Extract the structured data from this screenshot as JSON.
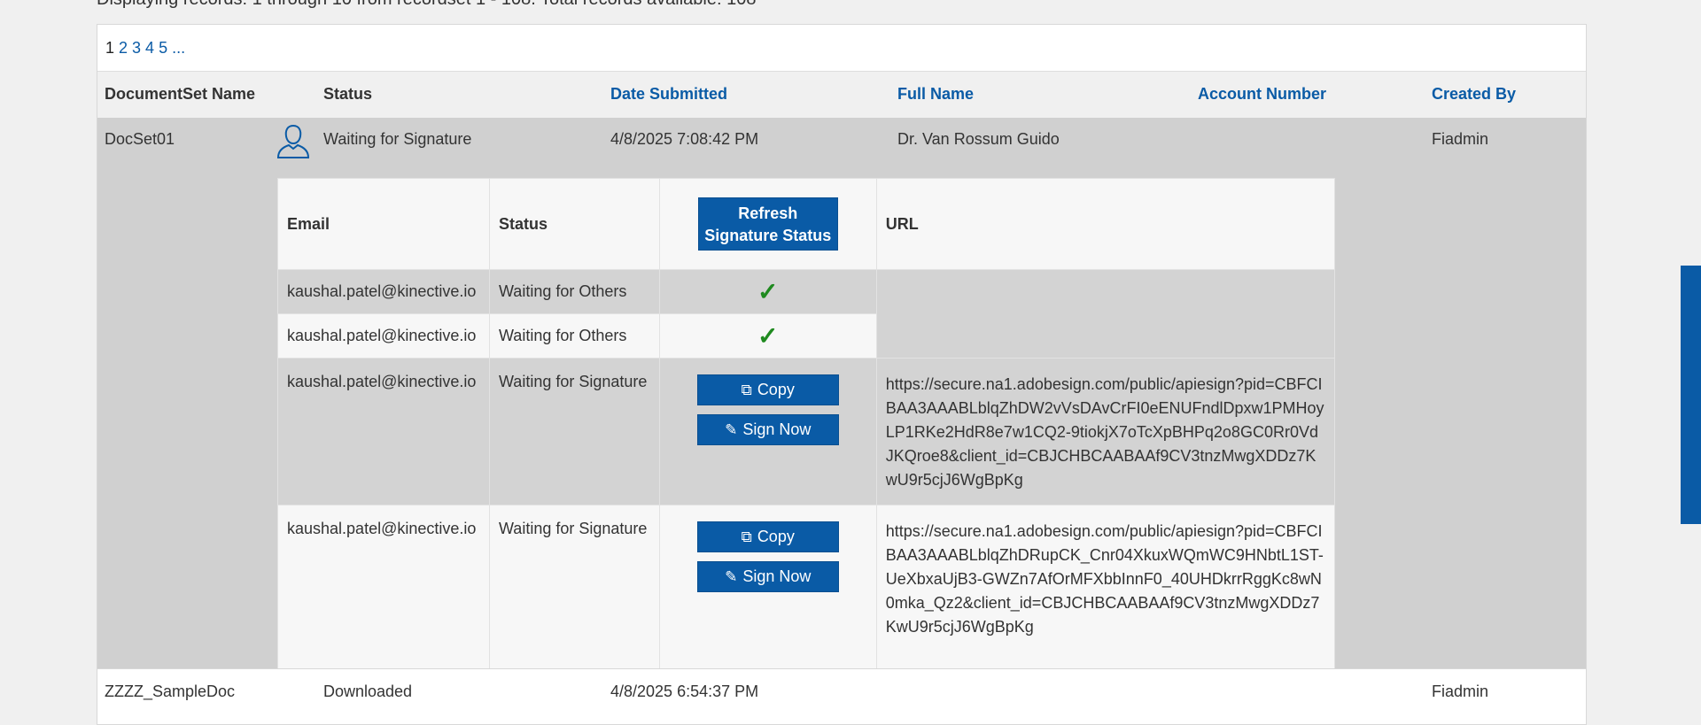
{
  "info": "Displaying records: 1 through 10 from recordset 1 - 108. Total records available: 108",
  "pager": {
    "pages": [
      "1",
      "2",
      "3",
      "4",
      "5"
    ],
    "ellipsis": "..."
  },
  "headers": {
    "docset_name": "DocumentSet Name",
    "status": "Status",
    "date_submitted": "Date Submitted",
    "full_name": "Full Name",
    "account_number": "Account Number",
    "created_by": "Created By"
  },
  "rows": [
    {
      "docset_name": "DocSet01",
      "status": "Waiting for Signature",
      "date_submitted": "4/8/2025 7:08:42 PM",
      "full_name": "Dr. Van Rossum Guido",
      "account_number": "",
      "created_by": "Fiadmin",
      "icon": "person-outline-icon"
    },
    {
      "docset_name": "ZZZZ_SampleDoc",
      "status": "Downloaded",
      "date_submitted": "4/8/2025 6:54:37 PM",
      "full_name": "",
      "account_number": "",
      "created_by": "Fiadmin"
    }
  ],
  "signers": {
    "headers": {
      "email": "Email",
      "status": "Status",
      "refresh_line1": "Refresh",
      "refresh_line2": "Signature Status",
      "url": "URL"
    },
    "buttons": {
      "copy": "Copy",
      "sign_now": "Sign Now"
    },
    "items": [
      {
        "email": "kaushal.patel@kinective.io",
        "status": "Waiting for Others",
        "check": "✓",
        "url": ""
      },
      {
        "email": "kaushal.patel@kinective.io",
        "status": "Waiting for Others",
        "check": "✓",
        "url": ""
      },
      {
        "email": "kaushal.patel@kinective.io",
        "status": "Waiting for Signature",
        "url": "https://secure.na1.adobesign.com/public/apiesign?pid=CBFCIBAA3AAABLblqZhDW2vVsDAvCrFI0eENUFndlDpxw1PMHoyLP1RKe2HdR8e7w1CQ2-9tiokjX7oTcXpBHPq2o8GC0Rr0VdJKQroe8&client_id=CBJCHBCAABAAf9CV3tnzMwgXDDz7KwU9r5cjJ6WgBpKg"
      },
      {
        "email": "kaushal.patel@kinective.io",
        "status": "Waiting for Signature",
        "url": "https://secure.na1.adobesign.com/public/apiesign?pid=CBFCIBAA3AAABLblqZhDRupCK_Cnr04XkuxWQmWC9HNbtL1ST-UeXbxaUjB3-GWZn7AfOrMFXbbInnF0_40UHDkrrRggKc8wN0mka_Qz2&client_id=CBJCHBCAABAAf9CV3tnzMwgXDDz7KwU9r5cjJ6WgBpKg"
      }
    ]
  },
  "colors": {
    "accent": "#0a5ba6",
    "check": "#1f8a1f",
    "expanded_row": "#d0d0d0"
  }
}
